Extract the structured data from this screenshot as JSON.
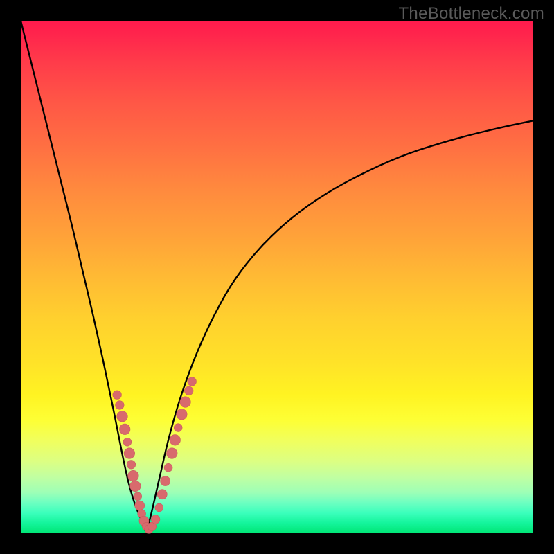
{
  "watermark": "TheBottleneck.com",
  "colors": {
    "curve": "#000000",
    "marker_fill": "#d86a6d",
    "marker_stroke": "#c95a5d",
    "frame_bg": "#000000"
  },
  "chart_data": {
    "type": "line",
    "title": "",
    "xlabel": "",
    "ylabel": "",
    "xlim": [
      0,
      100
    ],
    "ylim": [
      0,
      100
    ],
    "grid": false,
    "legend": false,
    "curve_left": {
      "comment": "left branch descending from top-left toward trough; y is % height from bottom (0) to top (100)",
      "x": [
        0.0,
        2.0,
        4.0,
        6.0,
        8.0,
        10.0,
        12.0,
        14.0,
        16.0,
        18.0,
        19.0,
        20.0,
        21.0,
        22.0,
        23.0,
        24.0,
        24.5
      ],
      "y": [
        100.0,
        92.0,
        84.0,
        76.0,
        68.0,
        60.0,
        51.5,
        43.0,
        34.0,
        24.5,
        19.5,
        14.5,
        10.0,
        6.5,
        3.8,
        1.7,
        0.5
      ]
    },
    "curve_right": {
      "comment": "right branch rising from trough toward upper-right, flattening out",
      "x": [
        24.5,
        25.5,
        27.0,
        29.0,
        31.5,
        34.5,
        38.0,
        42.0,
        47.0,
        53.0,
        60.0,
        68.0,
        76.0,
        85.0,
        93.0,
        100.0
      ],
      "y": [
        0.5,
        4.0,
        10.5,
        19.0,
        27.5,
        35.5,
        43.0,
        49.8,
        56.0,
        61.6,
        66.5,
        70.8,
        74.2,
        77.0,
        79.0,
        80.5
      ]
    },
    "markers": {
      "comment": "pink dot cluster near the trough along both branches; r is approximate radius in %-units",
      "points": [
        {
          "x": 18.8,
          "y": 27.0,
          "r": 0.85
        },
        {
          "x": 19.3,
          "y": 25.0,
          "r": 0.85
        },
        {
          "x": 19.8,
          "y": 22.8,
          "r": 1.05
        },
        {
          "x": 20.3,
          "y": 20.3,
          "r": 1.05
        },
        {
          "x": 20.8,
          "y": 17.8,
          "r": 0.8
        },
        {
          "x": 21.2,
          "y": 15.6,
          "r": 1.05
        },
        {
          "x": 21.55,
          "y": 13.4,
          "r": 0.85
        },
        {
          "x": 21.95,
          "y": 11.2,
          "r": 1.05
        },
        {
          "x": 22.35,
          "y": 9.2,
          "r": 1.05
        },
        {
          "x": 22.8,
          "y": 7.2,
          "r": 0.8
        },
        {
          "x": 23.2,
          "y": 5.4,
          "r": 0.95
        },
        {
          "x": 23.6,
          "y": 3.8,
          "r": 0.8
        },
        {
          "x": 24.05,
          "y": 2.4,
          "r": 0.95
        },
        {
          "x": 24.5,
          "y": 1.3,
          "r": 0.8
        },
        {
          "x": 25.0,
          "y": 0.8,
          "r": 0.85
        },
        {
          "x": 25.6,
          "y": 1.3,
          "r": 0.85
        },
        {
          "x": 26.3,
          "y": 2.7,
          "r": 0.85
        },
        {
          "x": 27.0,
          "y": 5.0,
          "r": 0.8
        },
        {
          "x": 27.6,
          "y": 7.6,
          "r": 0.95
        },
        {
          "x": 28.2,
          "y": 10.2,
          "r": 0.95
        },
        {
          "x": 28.8,
          "y": 12.8,
          "r": 0.8
        },
        {
          "x": 29.5,
          "y": 15.6,
          "r": 1.05
        },
        {
          "x": 30.1,
          "y": 18.2,
          "r": 1.05
        },
        {
          "x": 30.7,
          "y": 20.6,
          "r": 0.8
        },
        {
          "x": 31.4,
          "y": 23.2,
          "r": 1.05
        },
        {
          "x": 32.1,
          "y": 25.6,
          "r": 1.05
        },
        {
          "x": 32.8,
          "y": 27.8,
          "r": 0.85
        },
        {
          "x": 33.4,
          "y": 29.6,
          "r": 0.85
        }
      ]
    }
  }
}
